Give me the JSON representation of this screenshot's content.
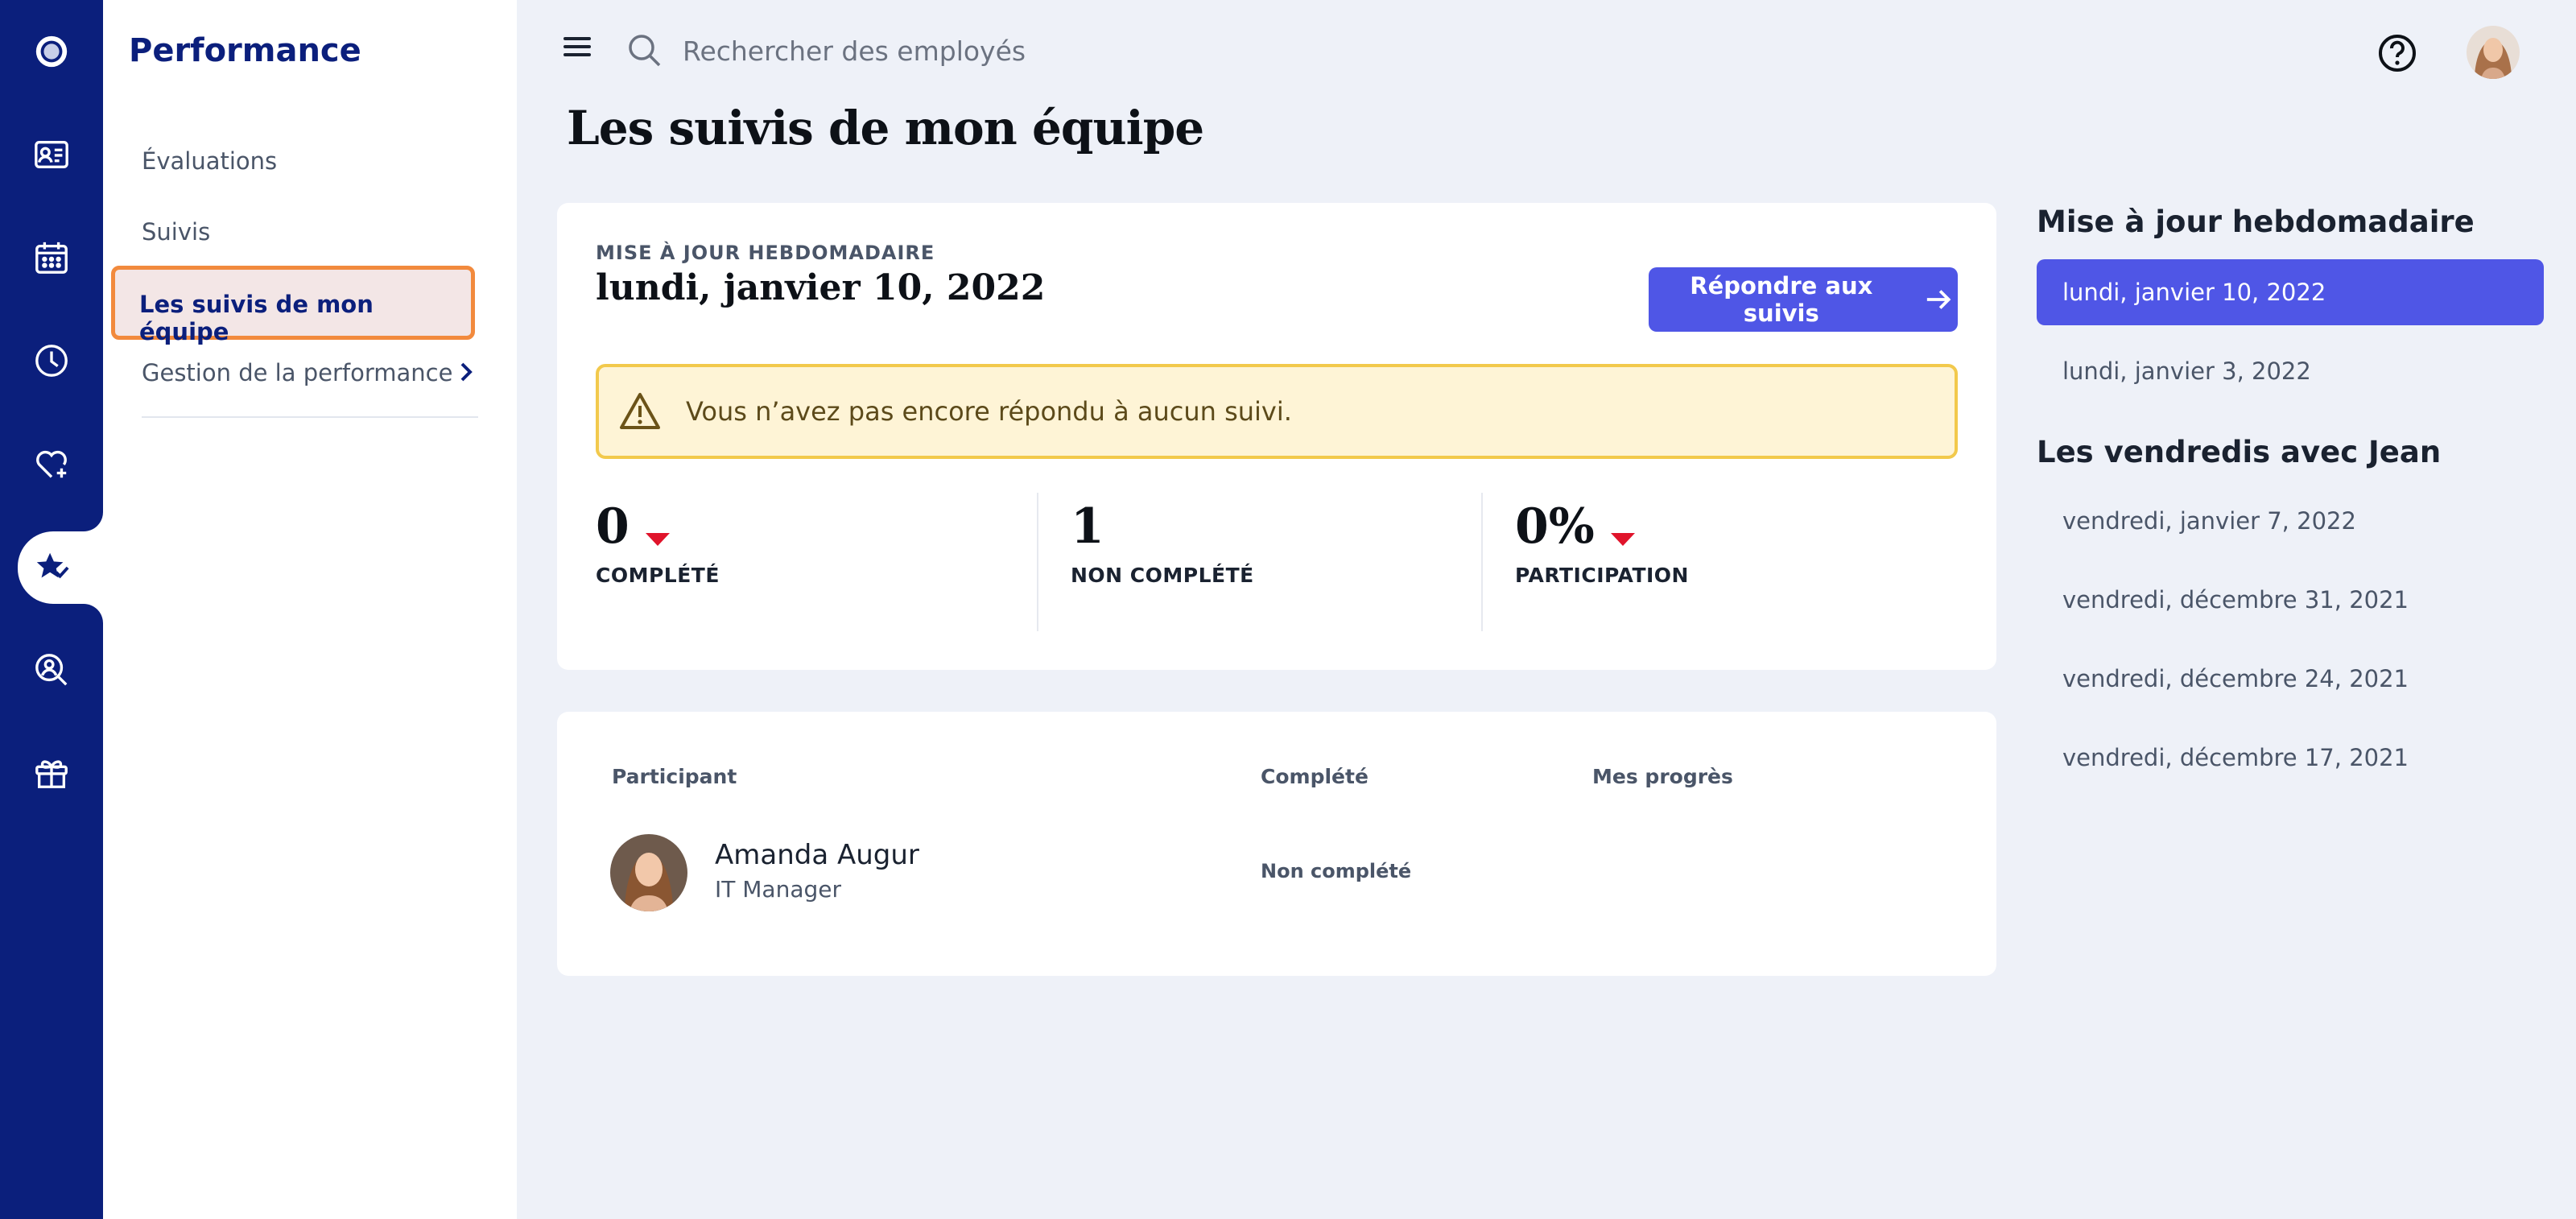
{
  "rail": {
    "items": [
      {
        "icon": "logo-icon"
      },
      {
        "icon": "id-card-icon"
      },
      {
        "icon": "calendar-icon"
      },
      {
        "icon": "clock-icon"
      },
      {
        "icon": "heart-plus-icon"
      },
      {
        "icon": "star-check-icon",
        "active": true
      },
      {
        "icon": "person-search-icon"
      },
      {
        "icon": "gift-box-icon"
      }
    ]
  },
  "sidebar": {
    "title": "Performance",
    "items": [
      {
        "label": "Évaluations"
      },
      {
        "label": "Suivis"
      },
      {
        "label": "Les suivis de mon équipe",
        "active": true
      },
      {
        "label": "Gestion de la performance",
        "has_chevron": true
      }
    ]
  },
  "topbar": {
    "search_placeholder": "Rechercher des employés"
  },
  "main": {
    "title": "Les suivis de mon équipe",
    "weekly": {
      "label": "MISE À JOUR HEBDOMADAIRE",
      "date": "lundi, janvier 10, 2022",
      "button_label": "Répondre aux suivis",
      "alert": "Vous n’avez pas encore répondu à aucun suivi.",
      "stats": [
        {
          "value": "0",
          "label": "COMPLÉTÉ",
          "trend": "down"
        },
        {
          "value": "1",
          "label": "NON COMPLÉTÉ"
        },
        {
          "value": "0%",
          "label": "PARTICIPATION",
          "trend": "down"
        }
      ]
    },
    "participants": {
      "columns": [
        "Participant",
        "Complété",
        "Mes progrès"
      ],
      "rows": [
        {
          "name": "Amanda Augur",
          "role": "IT Manager",
          "status": "Non complété"
        }
      ]
    }
  },
  "right": {
    "weekly_heading": "Mise à jour hebdomadaire",
    "weekly_dates": [
      "lundi, janvier 10, 2022",
      "lundi, janvier 3, 2022"
    ],
    "friday_heading": "Les vendredis avec Jean",
    "friday_dates": [
      "vendredi, janvier 7, 2022",
      "vendredi, décembre 31, 2021",
      "vendredi, décembre 24, 2021",
      "vendredi, décembre 17, 2021"
    ]
  },
  "colors": {
    "rail": "#0b1f7c",
    "accent": "#4f56e6",
    "active_outline": "#f28a3d",
    "alert_bg": "#fef4d6",
    "alert_border": "#f2c94c",
    "trend_down": "#e0142b"
  }
}
